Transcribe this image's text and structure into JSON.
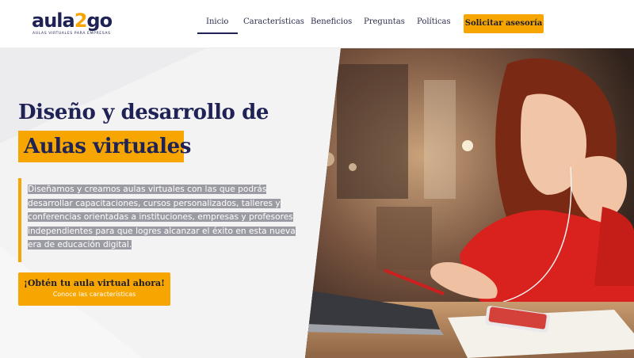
{
  "brand": {
    "name_main": "aula",
    "name_num": "2",
    "name_end": "go",
    "tagline": "AULAS VIRTUALES PARA EMPRESAS"
  },
  "nav": {
    "items": [
      {
        "label": "Inicio",
        "active": true
      },
      {
        "label": "Características",
        "active": false
      },
      {
        "label": "Beneficios",
        "active": false
      },
      {
        "label": "Preguntas",
        "active": false
      },
      {
        "label": "Políticas",
        "active": false
      }
    ],
    "cta_label": "Solicitar asesoría"
  },
  "hero": {
    "title_line1": "Diseño y desarrollo de",
    "title_highlight": "Aulas virtuales",
    "description": "Diseñamos y creamos aulas virtuales con las que podrás desarrollar capacitaciones, cursos personalizados, talleres y conferencias orientadas a instituciones, empresas y profesores independientes para que logres alcanzar el éxito en esta nueva era de educación digital.",
    "cta_line1": "¡Obtén tu aula virtual ahora!",
    "cta_line2": "Conoce las características"
  },
  "colors": {
    "brand_navy": "#1f2254",
    "accent_orange": "#f7a500",
    "text_highlight_gray": "#9b9ba3"
  }
}
